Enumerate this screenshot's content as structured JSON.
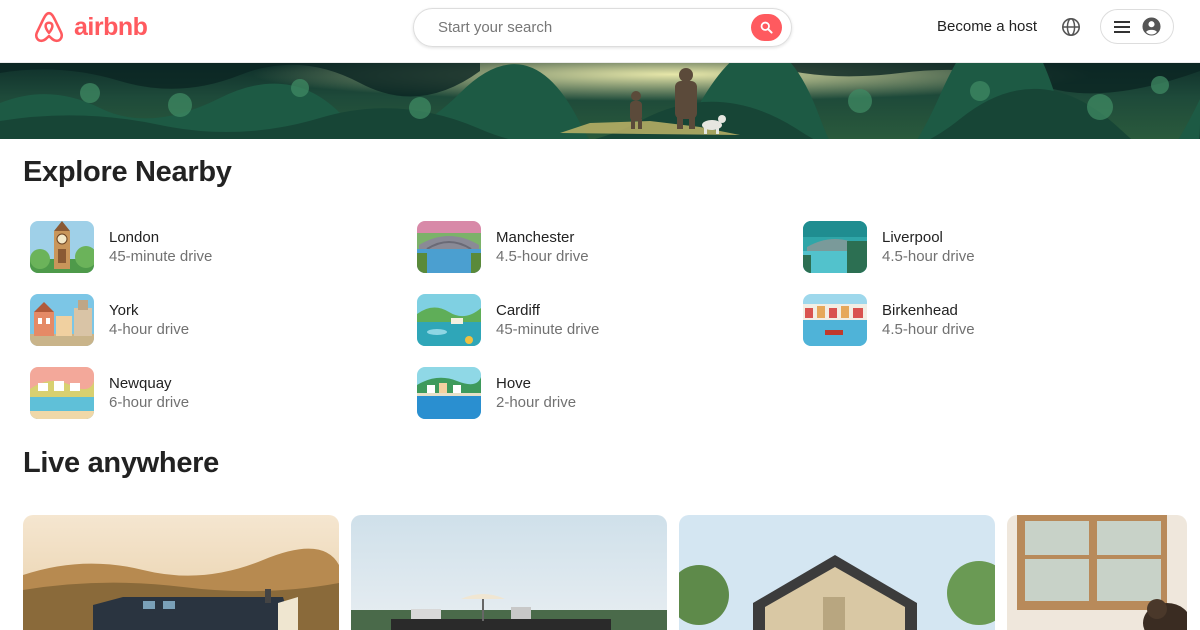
{
  "brand": {
    "name": "airbnb",
    "color": "#ff5a5f"
  },
  "search": {
    "placeholder": "Start your search",
    "icon": "search-icon"
  },
  "header": {
    "host_label": "Become a host",
    "language_icon": "globe-icon",
    "menu_icon": "hamburger-icon",
    "profile_icon": "user-icon"
  },
  "sections": {
    "explore_title": "Explore Nearby",
    "live_title": "Live anywhere"
  },
  "nearby": [
    {
      "city": "London",
      "drive": "45-minute drive"
    },
    {
      "city": "Manchester",
      "drive": "4.5-hour drive"
    },
    {
      "city": "Liverpool",
      "drive": "4.5-hour drive"
    },
    {
      "city": "York",
      "drive": "4-hour drive"
    },
    {
      "city": "Cardiff",
      "drive": "45-minute drive"
    },
    {
      "city": "Birkenhead",
      "drive": "4.5-hour drive"
    },
    {
      "city": "Newquay",
      "drive": "6-hour drive"
    },
    {
      "city": "Hove",
      "drive": "2-hour drive"
    }
  ]
}
